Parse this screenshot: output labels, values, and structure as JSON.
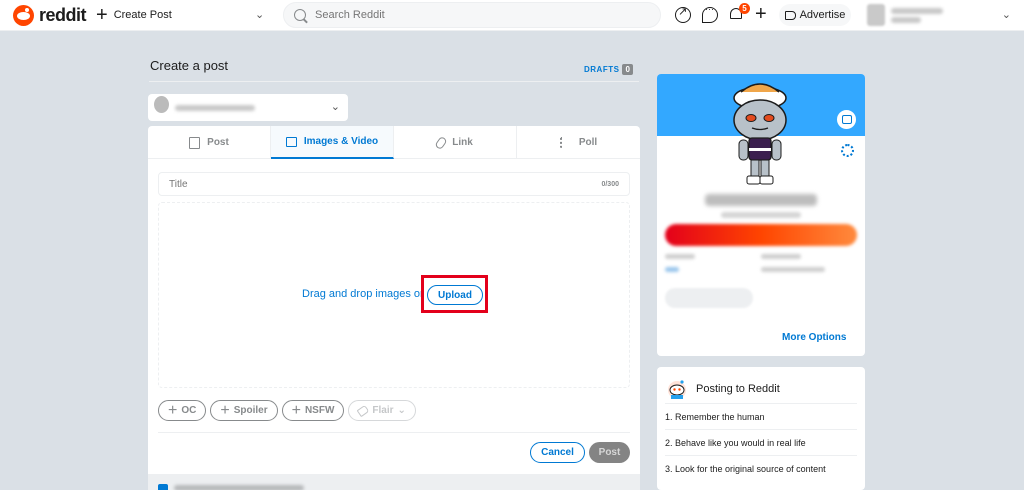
{
  "header": {
    "logo_text": "reddit",
    "create_post_label": "Create Post",
    "search_placeholder": "Search Reddit",
    "notification_count": "5",
    "advertise_label": "Advertise"
  },
  "page": {
    "title": "Create a post",
    "drafts_label": "DRAFTS",
    "drafts_count": "0"
  },
  "tabs": [
    {
      "label": "Post",
      "icon": "document-icon",
      "active": false
    },
    {
      "label": "Images & Video",
      "icon": "image-icon",
      "active": true
    },
    {
      "label": "Link",
      "icon": "link-icon",
      "active": false
    },
    {
      "label": "Poll",
      "icon": "poll-icon",
      "active": false
    }
  ],
  "composer": {
    "title_placeholder": "Title",
    "char_count": "0/300",
    "drop_text": "Drag and drop images or",
    "upload_label": "Upload",
    "tags": [
      {
        "label": "OC"
      },
      {
        "label": "Spoiler"
      },
      {
        "label": "NSFW"
      },
      {
        "label": "Flair"
      }
    ],
    "cancel_label": "Cancel",
    "post_label": "Post"
  },
  "profile": {
    "more_options_label": "More Options"
  },
  "rules": {
    "title": "Posting to Reddit",
    "items": [
      "1. Remember the human",
      "2. Behave like you would in real life",
      "3. Look for the original source of content"
    ]
  },
  "colors": {
    "accent": "#0079d3",
    "brand": "#ff4500",
    "highlight": "#e3001b",
    "banner": "#33a8ff",
    "background": "#dae0e6"
  }
}
